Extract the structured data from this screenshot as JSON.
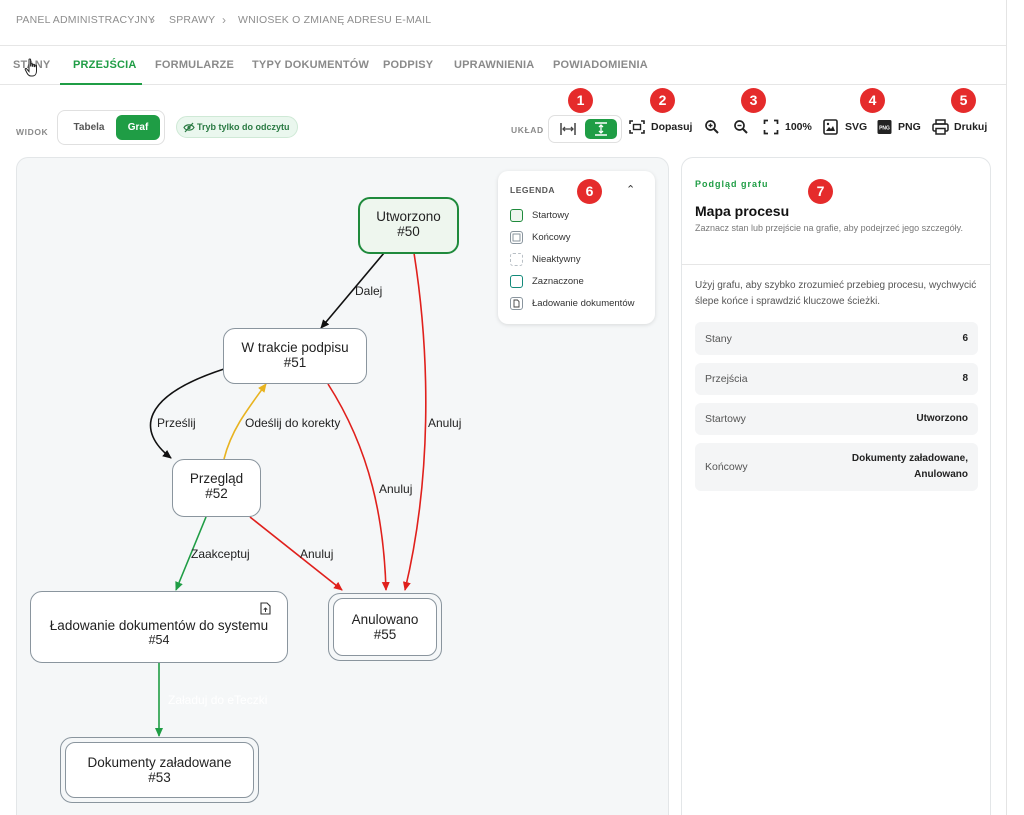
{
  "breadcrumb": {
    "items": [
      "PANEL ADMINISTRACYJNY",
      "SPRAWY",
      "WNIOSEK O ZMIANĘ ADRESU E-MAIL"
    ],
    "separator": "›"
  },
  "tabs": [
    {
      "label": "STANY",
      "active": false
    },
    {
      "label": "PRZEJŚCIA",
      "active": true
    },
    {
      "label": "FORMULARZE",
      "active": false
    },
    {
      "label": "TYPY DOKUMENTÓW",
      "active": false
    },
    {
      "label": "PODPISY",
      "active": false
    },
    {
      "label": "UPRAWNIENIA",
      "active": false
    },
    {
      "label": "POWIADOMIENIA",
      "active": false
    }
  ],
  "view": {
    "label": "WIDOK",
    "table_label": "Tabela",
    "graph_label": "Graf",
    "active": "Graf",
    "readonly_label": "Tryb tylko do odczytu"
  },
  "toolbar": {
    "layout_label": "UKŁAD",
    "layout_options": [
      "horizontal",
      "vertical"
    ],
    "layout_active": "vertical",
    "fit_label": "Dopasuj",
    "zoom_label": "100%",
    "svg_label": "SVG",
    "png_label": "PNG",
    "print_label": "Drukuj",
    "icons": [
      "arrows-horizontal-icon",
      "arrows-vertical-icon",
      "fit-screen-icon",
      "zoom-in-icon",
      "zoom-out-icon",
      "fullscreen-icon",
      "image-file-icon",
      "png-file-icon",
      "printer-icon"
    ]
  },
  "badges": [
    "1",
    "2",
    "3",
    "4",
    "5",
    "6",
    "7"
  ],
  "graph": {
    "nodes": {
      "n50": {
        "name": "Utworzono",
        "id": "#50",
        "type": "start"
      },
      "n51": {
        "name": "W trakcie podpisu",
        "id": "#51",
        "type": "normal"
      },
      "n52": {
        "name": "Przegląd",
        "id": "#52",
        "type": "normal"
      },
      "n54": {
        "name": "Ładowanie dokumentów do systemu",
        "id": "#54",
        "type": "upload"
      },
      "n55": {
        "name": "Anulowano",
        "id": "#55",
        "type": "final"
      },
      "n53": {
        "name": "Dokumenty załadowane",
        "id": "#53",
        "type": "final"
      }
    },
    "edges": {
      "e1": {
        "from": "#50",
        "to": "#51",
        "label": "Dalej",
        "color": "#111111"
      },
      "e2": {
        "from": "#51",
        "to": "#52",
        "label": "Prześlij",
        "color": "#111111"
      },
      "e3": {
        "from": "#52",
        "to": "#51",
        "label": "Odeślij do korekty",
        "color": "#e8b320"
      },
      "e4": {
        "from": "#51",
        "to": "#55",
        "label": "Anuluj",
        "color": "#e0201c"
      },
      "e5": {
        "from": "#50",
        "to": "#55",
        "label": "Anuluj",
        "color": "#e0201c"
      },
      "e6": {
        "from": "#52",
        "to": "#55",
        "label": "Anuluj",
        "color": "#e0201c"
      },
      "e7": {
        "from": "#52",
        "to": "#54",
        "label": "Zaakceptuj",
        "color": "#1f9d45"
      },
      "e8": {
        "from": "#54",
        "to": "#53",
        "label": "Załaduj do eTeczki",
        "color": "#1f9d45"
      }
    }
  },
  "legend": {
    "title": "LEGENDA",
    "items": [
      {
        "label": "Startowy",
        "color": "#1f8a3c"
      },
      {
        "label": "Końcowy",
        "color": "#8a959e"
      },
      {
        "label": "Nieaktywny",
        "color": "#b8bfc5"
      },
      {
        "label": "Zaznaczone",
        "color": "#138a7a"
      },
      {
        "label": "Ładowanie dokumentów",
        "color": "#8a959e"
      }
    ]
  },
  "panel": {
    "eyebrow": "Podgląd grafu",
    "title": "Mapa procesu",
    "subtitle": "Zaznacz stan lub przejście na grafie, aby podejrzeć jego szczegóły.",
    "description": "Użyj grafu, aby szybko zrozumieć przebieg procesu, wychwycić ślepe końce i sprawdzić kluczowe ścieżki.",
    "stats": [
      {
        "label": "Stany",
        "value": "6"
      },
      {
        "label": "Przejścia",
        "value": "8"
      },
      {
        "label": "Startowy",
        "value": "Utworzono"
      },
      {
        "label": "Końcowy",
        "value": "Dokumenty załadowane,\nAnulowano"
      }
    ]
  },
  "colors": {
    "accent": "#1f9d45",
    "badge": "#e52b2b",
    "cancel_edge": "#e0201c",
    "return_edge": "#e8b320"
  }
}
